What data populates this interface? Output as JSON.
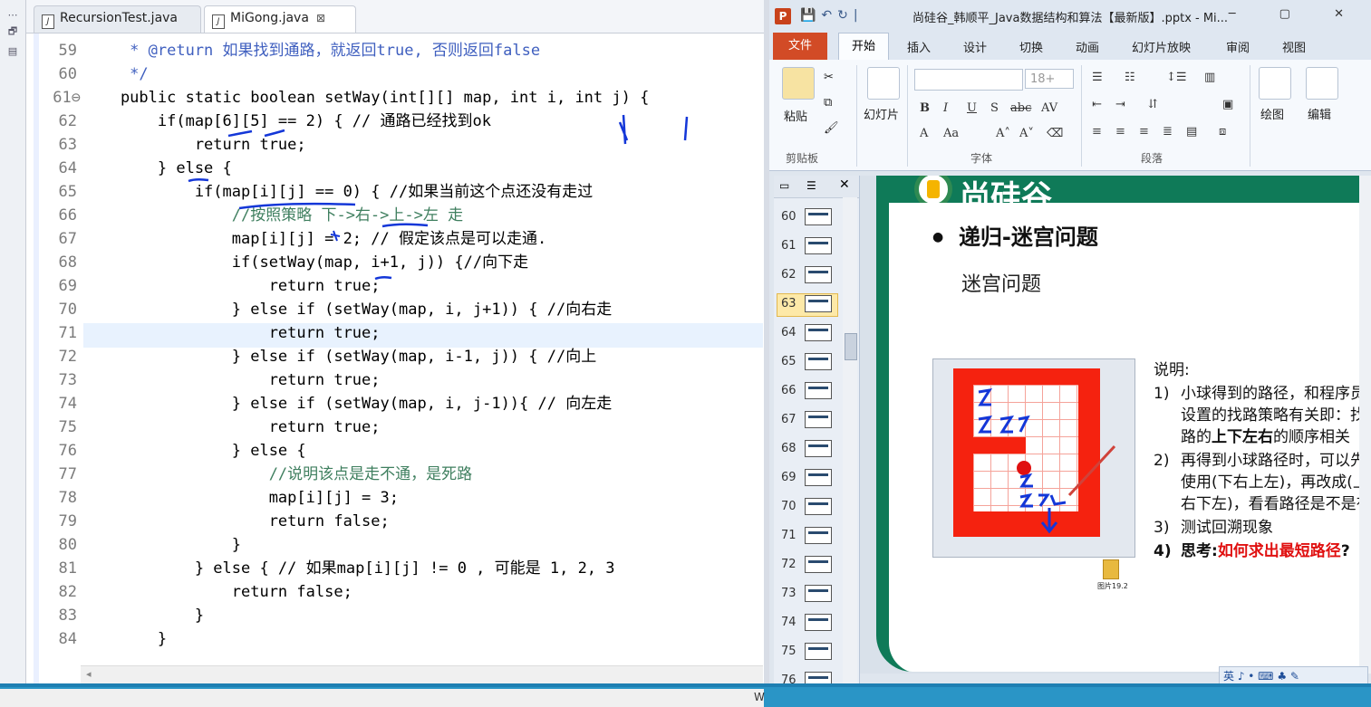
{
  "eclipse": {
    "tabs": [
      {
        "label": "RecursionTest.java",
        "active": false
      },
      {
        "label": "MiGong.java",
        "active": true,
        "close": "⊠"
      }
    ],
    "lines": [
      {
        "num": "59",
        "text": "     * @return 如果找到通路，就返回true, 否则返回false"
      },
      {
        "num": "60",
        "text": "     */"
      },
      {
        "num": "61⊖",
        "text": "    public static boolean setWay(int[][] map, int i, int j) {"
      },
      {
        "num": "62",
        "text": "        if(map[6][5] == 2) { // 通路已经找到ok"
      },
      {
        "num": "63",
        "text": "            return true;"
      },
      {
        "num": "64",
        "text": "        } else {"
      },
      {
        "num": "65",
        "text": "            if(map[i][j] == 0) { //如果当前这个点还没有走过"
      },
      {
        "num": "66",
        "text": "                //按照策略 下->右->上->左 走"
      },
      {
        "num": "67",
        "text": "                map[i][j] = 2; // 假定该点是可以走通."
      },
      {
        "num": "68",
        "text": "                if(setWay(map, i+1, j)) {//向下走"
      },
      {
        "num": "69",
        "text": "                    return true;"
      },
      {
        "num": "70",
        "text": "                } else if (setWay(map, i, j+1)) { //向右走"
      },
      {
        "num": "71",
        "text": "                    return true;"
      },
      {
        "num": "72",
        "text": "                } else if (setWay(map, i-1, j)) { //向上"
      },
      {
        "num": "73",
        "text": "                    return true;"
      },
      {
        "num": "74",
        "text": "                } else if (setWay(map, i, j-1)){ // 向左走"
      },
      {
        "num": "75",
        "text": "                    return true;"
      },
      {
        "num": "76",
        "text": "                } else {"
      },
      {
        "num": "77",
        "text": "                    //说明该点是走不通，是死路"
      },
      {
        "num": "78",
        "text": "                    map[i][j] = 3;"
      },
      {
        "num": "79",
        "text": "                    return false;"
      },
      {
        "num": "80",
        "text": "                }"
      },
      {
        "num": "81",
        "text": "            } else { // 如果map[i][j] != 0 , 可能是 1, 2, 3"
      },
      {
        "num": "82",
        "text": "                return false;"
      },
      {
        "num": "83",
        "text": "            }"
      },
      {
        "num": "84",
        "text": "        }"
      }
    ],
    "status_letter": "W"
  },
  "ppt": {
    "title": "尚硅谷_韩顺平_Java数据结构和算法【最新版】.pptx - Mi...",
    "window_controls": "─ ▢ ✕",
    "ribbon_tabs": [
      "文件",
      "开始",
      "插入",
      "设计",
      "切换",
      "动画",
      "幻灯片放映",
      "审阅",
      "视图"
    ],
    "groups": {
      "clipboard": "剪贴板",
      "paste": "粘贴",
      "slides_btn": "幻灯片",
      "font": "字体",
      "font_size": "18+",
      "paragraph": "段落",
      "draw": "绘图",
      "edit": "编辑"
    },
    "thumbnails": [
      "60",
      "61",
      "62",
      "63",
      "64",
      "65",
      "66",
      "67",
      "68",
      "69",
      "70",
      "71",
      "72",
      "73",
      "74",
      "75",
      "76"
    ],
    "selected_slide": "63",
    "slide": {
      "brand": "尚硅谷",
      "heading": "递归-迷宫问题",
      "subheading": "迷宫问题",
      "desc_title": "说明:",
      "items": [
        {
          "n": "1)",
          "line1": "小球得到的路径，和程序员",
          "line2": "设置的找路策略有关即：找",
          "line3a": "路的",
          "line3b": "上下左右",
          "line3c": "的顺序相关"
        },
        {
          "n": "2)",
          "line1": "再得到小球路径时，可以先",
          "line2": "使用(下右上左)，再改成(上",
          "line3": "右下左)，看看路径是不是有"
        },
        {
          "n": "3)",
          "line1": "测试回溯现象"
        },
        {
          "n": "4)",
          "line1a": "思考",
          "line1b": ":",
          "line1c": "如何求出最短路径",
          "line1d": "?"
        }
      ],
      "file_label": "图片19.2"
    },
    "ime": "英 ♪ • ⌨ ♣ ✎"
  }
}
